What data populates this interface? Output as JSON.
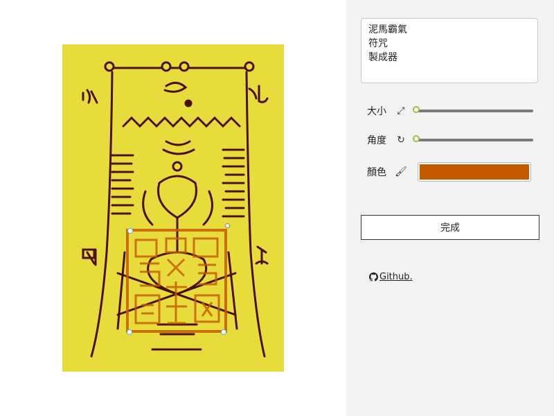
{
  "editor": {
    "talisman_text": "泥馬霸氣\n符咒\n製成器"
  },
  "controls": {
    "size_label": "大小",
    "size_value": 0,
    "angle_label": "角度",
    "angle_value": 0,
    "color_label": "顏色",
    "color_value": "#c45a00",
    "slider_thumb_color": "#9ac13b",
    "done_label": "完成"
  },
  "footer": {
    "github_label": " Github."
  },
  "artwork": {
    "paper_color": "#e7dc3c",
    "ink_color": "#4a0f08",
    "seal_color": "#c45a00"
  },
  "icons": {
    "size": "resize-expand-icon",
    "angle": "rotate-icon",
    "color": "paintbrush-icon",
    "github": "github-icon"
  }
}
